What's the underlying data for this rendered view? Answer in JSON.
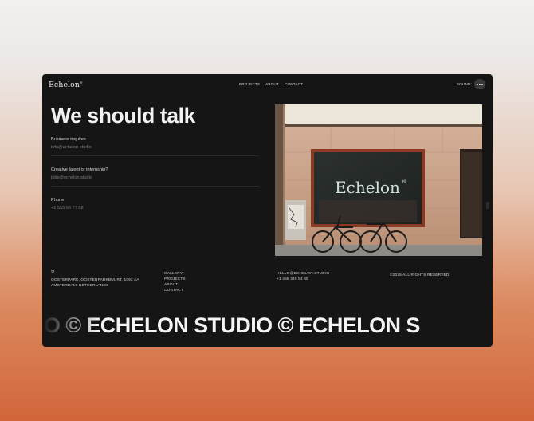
{
  "header": {
    "logo": "Echelon",
    "logo_mark": "®",
    "nav": [
      "PROJECTS",
      "ABOUT",
      "CONTACT"
    ],
    "sound_label": "SOUND:"
  },
  "main": {
    "headline": "We should talk",
    "contacts": [
      {
        "label": "Business inquires",
        "value": "info@echelon.studio"
      },
      {
        "label": "Creative talent or internship?",
        "value": "jobs@echelon.studio"
      },
      {
        "label": "Phone",
        "value": "+1 555 66 77 88"
      }
    ],
    "photo_sign": "Echelon",
    "photo_sign_mark": "®"
  },
  "footer": {
    "address_line1": "OOSTERPARK, OOSTERPARKBUURT, 1092 AA",
    "address_line2": "AMSTERDAM, NETHERLANDS",
    "links": [
      "GALLERY",
      "PROJECTS",
      "ABOUT",
      "CONTACT"
    ],
    "email": "HELLO@ECHELON.STUDIO",
    "phone": "+1 456 345 54 45",
    "copyright": "©2025 ALL RIGHTS RESERVED"
  },
  "marquee": "IO © ECHELON STUDIO © ECHELON S"
}
